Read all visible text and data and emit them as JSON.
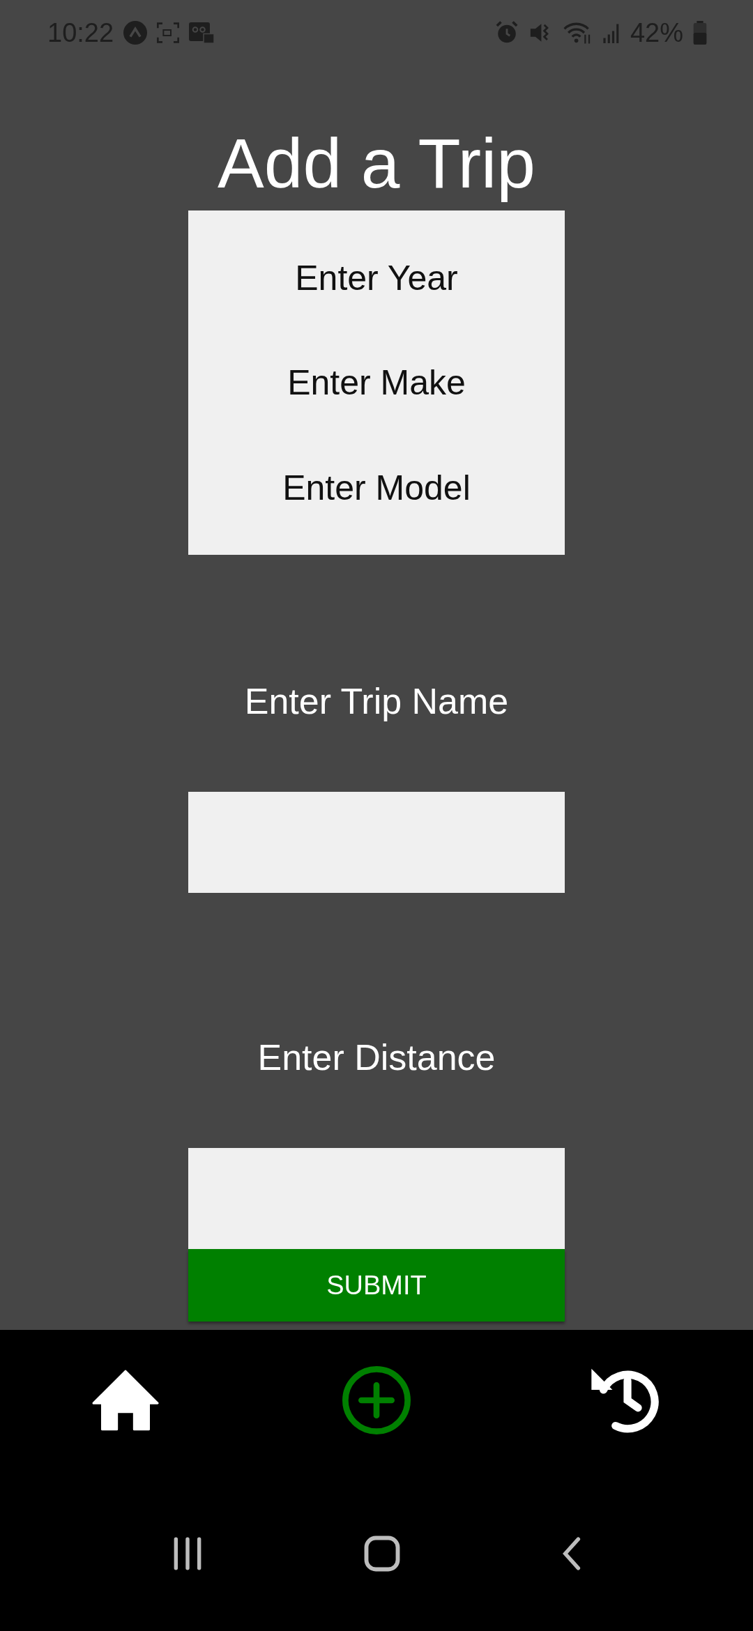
{
  "status_bar": {
    "time": "10:22",
    "battery": "42%"
  },
  "title": "Add a Trip",
  "vehicle_fields": [
    {
      "placeholder": "Enter Year"
    },
    {
      "placeholder": "Enter Make"
    },
    {
      "placeholder": "Enter Model"
    }
  ],
  "trip_name": {
    "label": "Enter Trip Name"
  },
  "distance": {
    "label": "Enter Distance"
  },
  "submit_button": "SUBMIT",
  "tabs": [
    {
      "kind": "home",
      "selected": false
    },
    {
      "kind": "add",
      "selected": true
    },
    {
      "kind": "history",
      "selected": false
    }
  ]
}
